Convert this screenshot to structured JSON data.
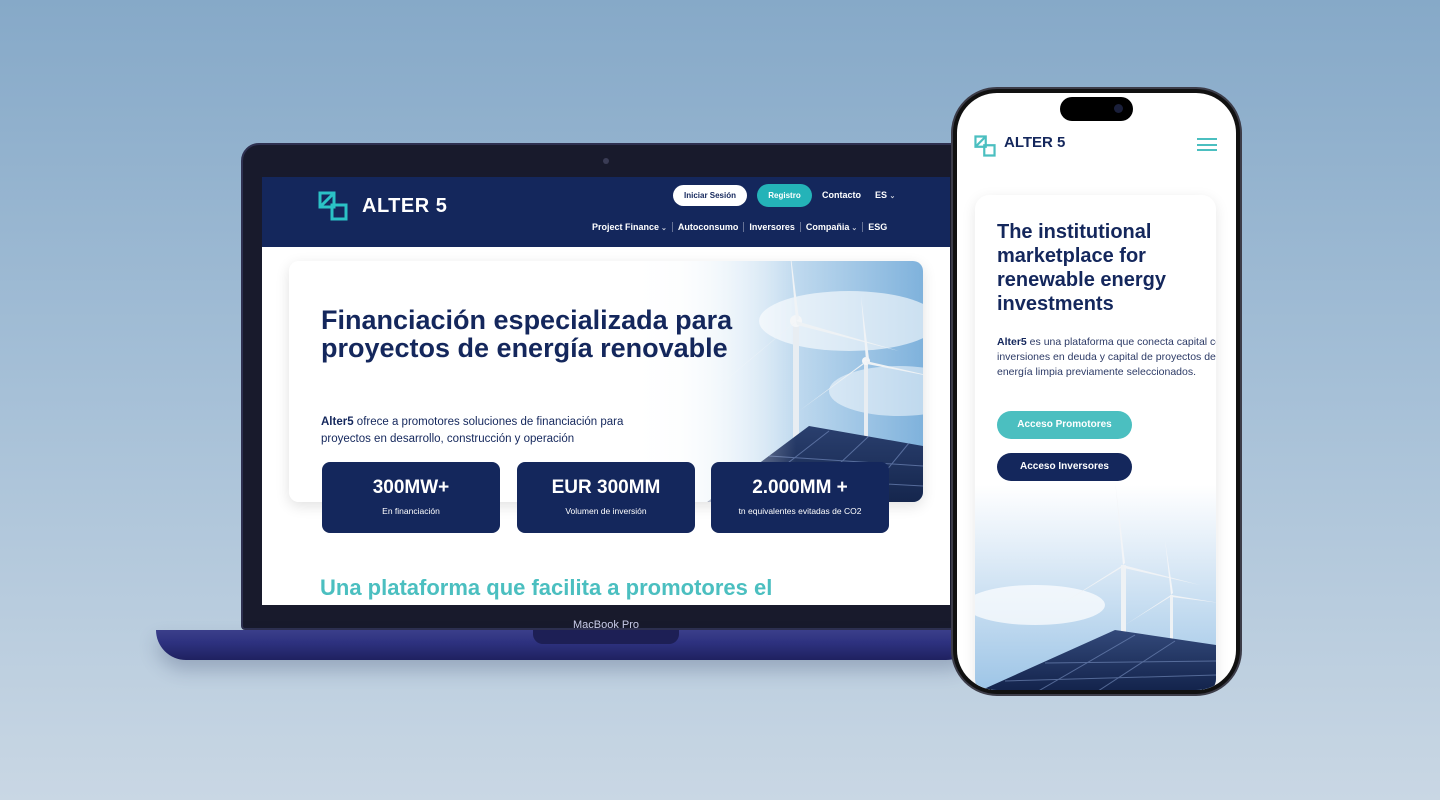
{
  "desktop": {
    "brand": "ALTER 5",
    "header": {
      "login_label": "Iniciar Sesión",
      "register_label": "Registro",
      "contact_label": "Contacto",
      "lang_label": "ES",
      "nav": [
        "Project Finance",
        "Autoconsumo",
        "Inversores",
        "Compañia",
        "ESG"
      ]
    },
    "hero": {
      "title": "Financiación especializada para proyectos de energía renovable",
      "desc_brand": "Alter5",
      "desc_rest": " ofrece a promotores soluciones de financiación para proyectos en desarrollo, construcción y operación"
    },
    "stats": [
      {
        "value": "300MW+",
        "label": "En financiación"
      },
      {
        "value": "EUR 300MM",
        "label": "Volumen de inversión"
      },
      {
        "value": "2.000MM +",
        "label": "tn equivalentes evitadas de CO2"
      }
    ],
    "section_title": "Una plataforma que facilita a promotores el"
  },
  "device_label": "MacBook Pro",
  "mobile": {
    "brand": "ALTER 5",
    "title": "The institutional marketplace for renewable energy investments",
    "desc_brand": "Alter5",
    "desc_rest": " es una plataforma que conecta capital con inversiones en deuda y capital de proyectos de energía limpia previamente seleccionados.",
    "btn_promoters": "Acceso Promotores",
    "btn_investors": "Acceso Inversores"
  },
  "colors": {
    "navy": "#14275c",
    "teal": "#24b3b8",
    "teal_light": "#4bbfc0"
  }
}
